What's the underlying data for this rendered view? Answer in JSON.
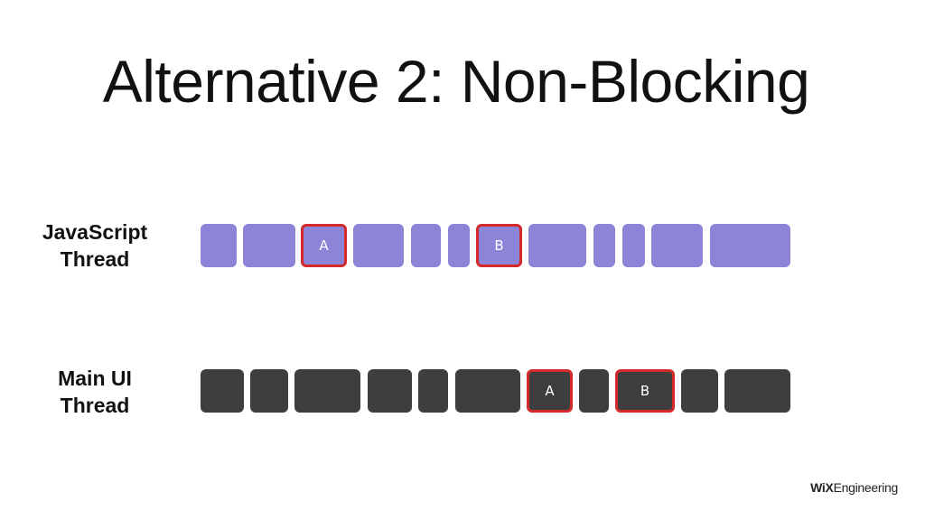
{
  "title": "Alternative 2: Non-Blocking",
  "rows": {
    "js": {
      "label_line1": "JavaScript",
      "label_line2": "Thread",
      "color": "#8b84d7",
      "task_labels": [
        "A",
        "B"
      ]
    },
    "ui": {
      "label_line1": "Main UI",
      "label_line2": "Thread",
      "color": "#3e3e3e",
      "task_labels": [
        "A",
        "B"
      ]
    }
  },
  "highlight_color": "#d42a2a",
  "brand": {
    "bold": "WiX",
    "rest": "Engineering"
  }
}
